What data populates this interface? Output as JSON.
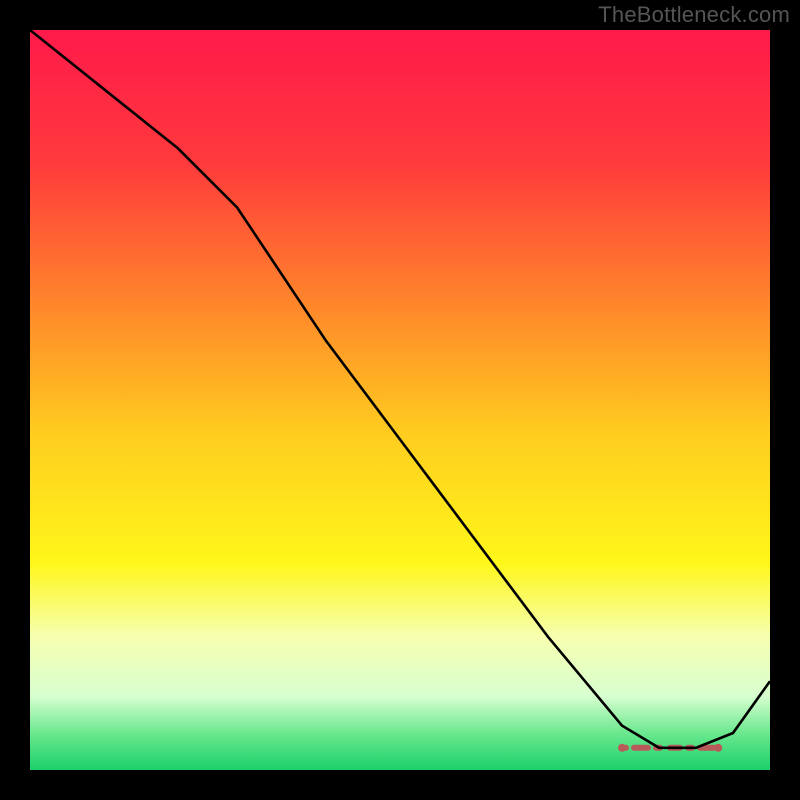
{
  "watermark": "TheBottleneck.com",
  "chart_data": {
    "type": "line",
    "title": "",
    "xlabel": "",
    "ylabel": "",
    "xlim": [
      0,
      100
    ],
    "ylim": [
      0,
      100
    ],
    "gradient_stops": [
      {
        "offset": 0,
        "color": "#ff1a4b"
      },
      {
        "offset": 18,
        "color": "#ff3a3c"
      },
      {
        "offset": 38,
        "color": "#ff8a2a"
      },
      {
        "offset": 55,
        "color": "#ffce1f"
      },
      {
        "offset": 72,
        "color": "#fff71a"
      },
      {
        "offset": 82,
        "color": "#f6ffb0"
      },
      {
        "offset": 90,
        "color": "#d8ffd0"
      },
      {
        "offset": 95,
        "color": "#6be88f"
      },
      {
        "offset": 100,
        "color": "#1bd06a"
      }
    ],
    "series": [
      {
        "name": "curve",
        "x": [
          0,
          10,
          20,
          28,
          40,
          55,
          70,
          80,
          85,
          90,
          95,
          100
        ],
        "y": [
          100,
          92,
          84,
          76,
          58,
          38,
          18,
          6,
          3,
          3,
          5,
          12
        ]
      }
    ],
    "marker_band": {
      "x_start": 80,
      "x_end": 93,
      "y": 3,
      "color": "#b85a5a"
    }
  }
}
